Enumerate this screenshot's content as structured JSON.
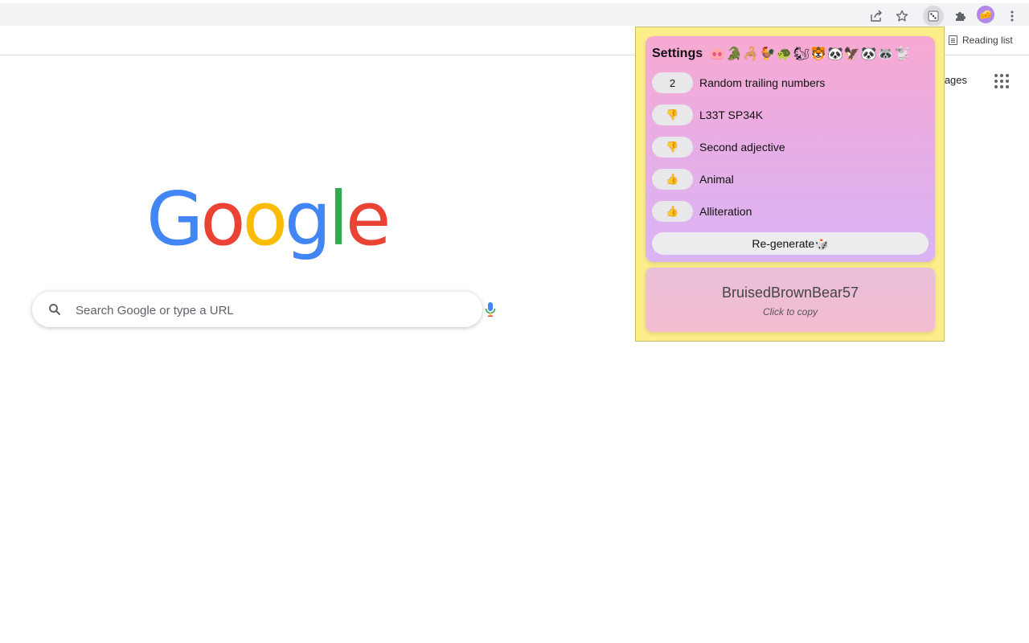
{
  "toolbar": {
    "share_icon": "share-icon",
    "bookmark_icon": "star-icon",
    "extension_icon": "dice-icon",
    "extensions_icon": "puzzle-icon",
    "profile_icon": "avatar",
    "menu_icon": "kebab-menu-icon"
  },
  "bookmarks_bar": {
    "reading_list_label": "Reading list"
  },
  "google_page": {
    "images_link": "mages",
    "logo_letters": [
      {
        "char": "G",
        "color": "#4285F4"
      },
      {
        "char": "o",
        "color": "#EA4335"
      },
      {
        "char": "o",
        "color": "#FBBC05"
      },
      {
        "char": "g",
        "color": "#4285F4"
      },
      {
        "char": "l",
        "color": "#34A853"
      },
      {
        "char": "e",
        "color": "#EA4335"
      }
    ],
    "search_placeholder": "Search Google or type a URL"
  },
  "popup": {
    "settings_title": "Settings",
    "animal_emojis": "🐽🐊🦂🐓🐢🐿🐯🐼🦅🐼🦝🐩",
    "settings": [
      {
        "pill": "2",
        "label": "Random trailing numbers"
      },
      {
        "pill": "👎",
        "label": "L33T SP34K"
      },
      {
        "pill": "👎",
        "label": "Second adjective"
      },
      {
        "pill": "👍",
        "label": "Animal"
      },
      {
        "pill": "👍",
        "label": "Alliteration"
      }
    ],
    "regenerate_label": "Re-generate🎲",
    "generated_name": "BruisedBrownBear57",
    "copy_hint": "Click to copy"
  },
  "colors": {
    "popup_background": "#fdee8a",
    "settings_gradient_top": "#f7a9d2",
    "settings_gradient_bottom": "#d9b4f5",
    "result_gradient": "#f4bcd0"
  }
}
